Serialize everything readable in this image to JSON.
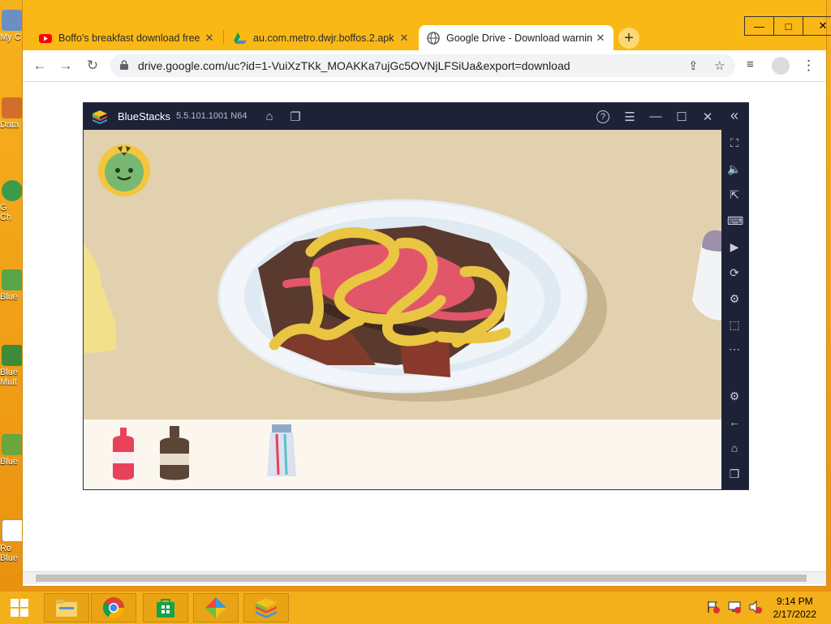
{
  "window_controls": {
    "minimize": "—",
    "maximize": "□",
    "close": "✕"
  },
  "tabs": [
    {
      "title": "Boffo's breakfast download free |",
      "favicon": "youtube-icon",
      "close": "✕"
    },
    {
      "title": "au.com.metro.dwjr.boffos.2.apk -",
      "favicon": "google-drive-icon",
      "close": "✕"
    },
    {
      "title": "Google Drive - Download warnin",
      "favicon": "globe-icon",
      "close": "✕"
    }
  ],
  "new_tab": "+",
  "toolbar": {
    "back": "←",
    "forward": "→",
    "reload": "↻",
    "url": "drive.google.com/uc?id=1-VuiXzTKk_MOAKKa7ujGc5OVNjLFSiUa&export=download",
    "share": "⇪",
    "star": "☆",
    "media": "≡",
    "menu": "⋮"
  },
  "bluestacks": {
    "name": "BlueStacks",
    "version": "5.5.101.1001 N64",
    "title_buttons": {
      "home": "⌂",
      "multi": "❐",
      "help": "?",
      "menu": "☰",
      "min": "—",
      "max": "☐",
      "close": "✕",
      "collapse": "«"
    },
    "sidebar": [
      "⛶",
      "🔈",
      "⇱",
      "⌨",
      "▶",
      "⟳",
      "⚙",
      "⬚",
      "⋯",
      "⚙",
      "←",
      "⌂",
      "❐"
    ]
  },
  "taskbar": {
    "time": "9:14 PM",
    "date": "2/17/2022"
  },
  "colors": {
    "desktop": "#f6b21d",
    "bluestacks_frame": "#1e2237",
    "game_bg": "#e2d1ae"
  }
}
